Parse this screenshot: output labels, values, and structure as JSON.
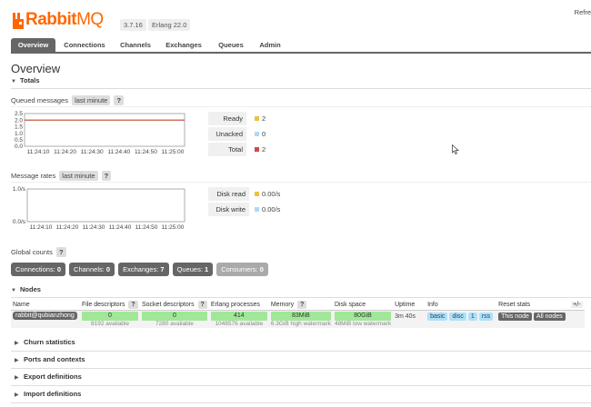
{
  "header": {
    "brand_rabbit": "Rabbit",
    "brand_mq": "MQ",
    "version": "3.7.16",
    "erlang": "Erlang 22.0",
    "refresh": "Refre"
  },
  "tabs": [
    {
      "label": "Overview",
      "active": true
    },
    {
      "label": "Connections"
    },
    {
      "label": "Channels"
    },
    {
      "label": "Exchanges"
    },
    {
      "label": "Queues"
    },
    {
      "label": "Admin"
    }
  ],
  "page_title": "Overview",
  "totals": {
    "label": "Totals",
    "queued_label": "Queued messages",
    "queued_range": "last minute",
    "rates_label": "Message rates",
    "rates_range": "last minute",
    "help": "?"
  },
  "chart_data": [
    {
      "type": "line",
      "x": [
        "11:24:10",
        "11:24:20",
        "11:24:30",
        "11:24:40",
        "11:24:50",
        "11:25:00"
      ],
      "ylim": [
        0,
        2.5
      ],
      "yticks": [
        "2.5",
        "2.0",
        "1.5",
        "1.0",
        "0.5",
        "0.0"
      ],
      "series": [
        {
          "name": "Ready",
          "color": "#edc240",
          "values": [
            2,
            2,
            2,
            2,
            2,
            2
          ]
        },
        {
          "name": "Unacked",
          "color": "#afd8f8",
          "values": [
            0,
            0,
            0,
            0,
            0,
            0
          ]
        },
        {
          "name": "Total",
          "color": "#cb4b4b",
          "values": [
            2,
            2,
            2,
            2,
            2,
            2
          ]
        }
      ],
      "legend": [
        {
          "name": "Ready",
          "value": "2",
          "color": "#edc240"
        },
        {
          "name": "Unacked",
          "value": "0",
          "color": "#afd8f8"
        },
        {
          "name": "Total",
          "value": "2",
          "color": "#cb4b4b"
        }
      ]
    },
    {
      "type": "line",
      "x": [
        "11:24:10",
        "11:24:20",
        "11:24:30",
        "11:24:40",
        "11:24:50",
        "11:25:00"
      ],
      "ylim": [
        0,
        1
      ],
      "yticks": [
        "1.0/s",
        "0.0/s"
      ],
      "series": [
        {
          "name": "Disk read",
          "color": "#edc240",
          "values": [
            0,
            0,
            0,
            0,
            0,
            0
          ]
        },
        {
          "name": "Disk write",
          "color": "#afd8f8",
          "values": [
            0,
            0,
            0,
            0,
            0,
            0
          ]
        }
      ],
      "legend": [
        {
          "name": "Disk read",
          "value": "0.00/s",
          "color": "#edc240"
        },
        {
          "name": "Disk write",
          "value": "0.00/s",
          "color": "#afd8f8"
        }
      ]
    }
  ],
  "global_counts": {
    "label": "Global counts",
    "items": [
      {
        "label": "Connections:",
        "value": "0"
      },
      {
        "label": "Channels:",
        "value": "0"
      },
      {
        "label": "Exchanges:",
        "value": "7"
      },
      {
        "label": "Queues:",
        "value": "1"
      },
      {
        "label": "Consumers:",
        "value": "0",
        "dim": true
      }
    ]
  },
  "nodes": {
    "label": "Nodes",
    "columns": [
      "Name",
      "File descriptors",
      "Socket descriptors",
      "Erlang processes",
      "Memory",
      "Disk space",
      "Uptime",
      "Info",
      "Reset stats",
      "+/-"
    ],
    "row": {
      "name": "rabbit@qubianzhong",
      "fd": "0",
      "fd_sub": "8192 available",
      "sd": "0",
      "sd_sub": "7280 available",
      "ep": "414",
      "ep_sub": "1048576 available",
      "mem": "83MiB",
      "mem_sub": "6.3GiB high watermark",
      "disk": "80GiB",
      "disk_sub": "48MiB low watermark",
      "uptime": "3m 40s",
      "info": [
        "basic",
        "disc",
        "1",
        "rss"
      ],
      "reset": [
        "This node",
        "All nodes"
      ]
    }
  },
  "collapsed_sections": [
    "Churn statistics",
    "Ports and contexts",
    "Export definitions",
    "Import definitions"
  ]
}
